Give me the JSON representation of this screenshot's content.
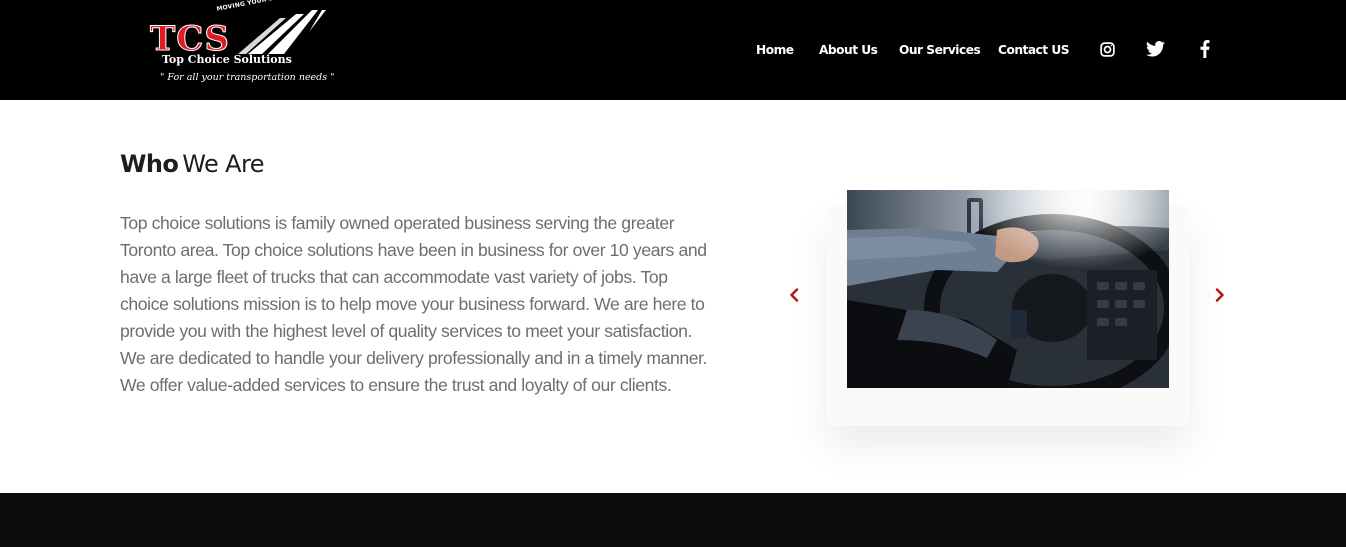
{
  "brand": {
    "logo_mark": "TCS",
    "tagline_top": "MOVING YOUR BUSINESS FORWARD",
    "name": "Top Choice Solutions",
    "slogan": "\" For all your transportation needs \"",
    "colors": {
      "red": "#e01b22",
      "black": "#000000",
      "white": "#ffffff"
    }
  },
  "nav": {
    "items": [
      {
        "label": "Home"
      },
      {
        "label": "About Us"
      },
      {
        "label": "Our Services"
      },
      {
        "label": "Contact US"
      }
    ]
  },
  "social": {
    "icons": [
      "instagram-icon",
      "twitter-icon",
      "facebook-icon"
    ]
  },
  "about": {
    "title_strong": "Who",
    "title_light": "We Are",
    "body": "Top choice solutions is family owned operated business serving the greater Toronto area. Top choice solutions have been in business for over 10 years and have a large fleet of trucks that can accommodate vast variety of jobs. Top choice solutions mission is to help move your business forward. We are here to provide you with the highest level of quality services to meet your satisfaction. We are dedicated to handle your delivery professionally and in a timely manner. We offer value-added services to ensure the trust and loyalty of our clients."
  },
  "slider": {
    "arrow_color": "#b31217",
    "prev_icon": "chevron-left-icon",
    "next_icon": "chevron-right-icon",
    "image_subject": "truck driver hands on steering wheel"
  },
  "theme": {
    "header_bg": "#000000",
    "footer_bg": "#0c0c0c",
    "heading_color": "#1d1d1d",
    "body_text_color": "#6e6e6e"
  }
}
